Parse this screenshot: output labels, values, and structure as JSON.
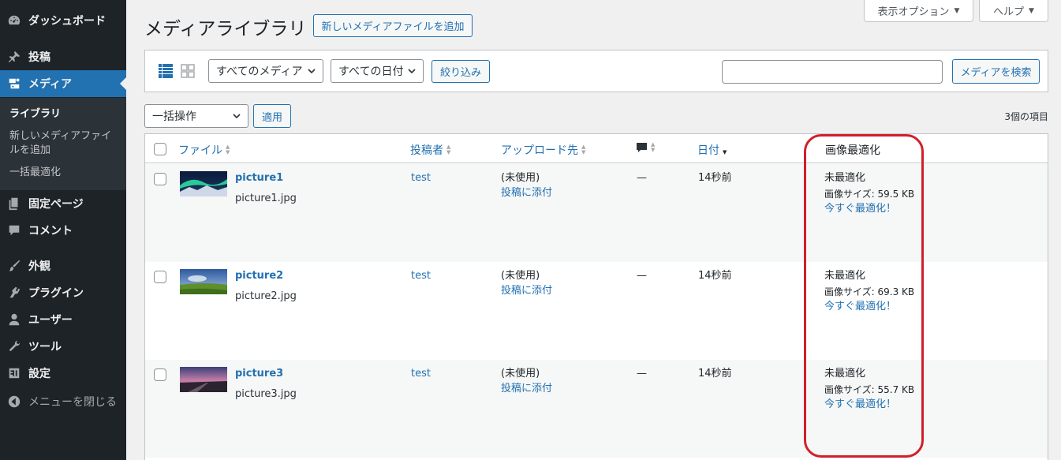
{
  "sidebar": {
    "items": [
      {
        "label": "ダッシュボード",
        "icon": "dashboard-icon"
      },
      {
        "label": "投稿",
        "icon": "pushpin-icon"
      },
      {
        "label": "メディア",
        "icon": "media-icon"
      },
      {
        "label": "固定ページ",
        "icon": "pages-icon"
      },
      {
        "label": "コメント",
        "icon": "comment-icon"
      },
      {
        "label": "外観",
        "icon": "brush-icon"
      },
      {
        "label": "プラグイン",
        "icon": "plugin-icon"
      },
      {
        "label": "ユーザー",
        "icon": "user-icon"
      },
      {
        "label": "ツール",
        "icon": "wrench-icon"
      },
      {
        "label": "設定",
        "icon": "settings-icon"
      },
      {
        "label": "メニューを閉じる",
        "icon": "collapse-icon"
      }
    ],
    "submenu": [
      "ライブラリ",
      "新しいメディアファイルを追加",
      "一括最適化"
    ]
  },
  "top_tabs": {
    "screen_options": "表示オプション",
    "help": "ヘルプ"
  },
  "header": {
    "title": "メディアライブラリ",
    "add_new": "新しいメディアファイルを追加"
  },
  "filters": {
    "media_type": "すべてのメディア",
    "date": "すべての日付",
    "filter_button": "絞り込み",
    "search_value": "",
    "search_button": "メディアを検索"
  },
  "bulk": {
    "action": "一括操作",
    "apply": "適用",
    "count": "3個の項目"
  },
  "table": {
    "columns": {
      "file": "ファイル",
      "author": "投稿者",
      "uploaded_to": "アップロード先",
      "date": "日付",
      "optimize": "画像最適化"
    },
    "rows": [
      {
        "title": "picture1",
        "filename": "picture1.jpg",
        "author": "test",
        "uploaded": "(未使用)",
        "attach": "投稿に添付",
        "comments": "—",
        "date": "14秒前",
        "status": "未最適化",
        "size": "画像サイズ: 59.5 KB",
        "action": "今すぐ最適化！"
      },
      {
        "title": "picture2",
        "filename": "picture2.jpg",
        "author": "test",
        "uploaded": "(未使用)",
        "attach": "投稿に添付",
        "comments": "—",
        "date": "14秒前",
        "status": "未最適化",
        "size": "画像サイズ: 69.3 KB",
        "action": "今すぐ最適化！"
      },
      {
        "title": "picture3",
        "filename": "picture3.jpg",
        "author": "test",
        "uploaded": "(未使用)",
        "attach": "投稿に添付",
        "comments": "—",
        "date": "14秒前",
        "status": "未最適化",
        "size": "画像サイズ: 55.7 KB",
        "action": "今すぐ最適化！"
      }
    ]
  },
  "colors": {
    "sidebar_bg": "#1d2327",
    "accent": "#2271b1",
    "highlight": "#d0202a"
  }
}
